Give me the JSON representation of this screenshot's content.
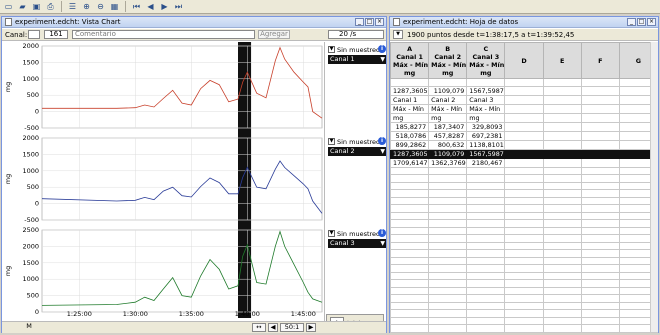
{
  "toolbar": {
    "icons": [
      "new-icon",
      "open-icon",
      "save-icon",
      "print-icon",
      "list-icon",
      "zoom-in-icon",
      "zoom-out-icon",
      "spreadsheet-icon",
      "first-icon",
      "prev-icon",
      "next-icon",
      "last-icon"
    ]
  },
  "chart_window": {
    "title": "experiment.edchtː Vista Chart",
    "canal_label": "Canal:",
    "canal_number": "161",
    "comment_placeholder": "Comentario",
    "add_button": "Agregar",
    "rate": "20 /s",
    "channels": [
      {
        "name": "Canal 1",
        "sampling": "Sin muestreo",
        "color": "#c8402b",
        "unit": "mg",
        "yticks": [
          "2000",
          "1500",
          "1000",
          "500",
          "0",
          "-500"
        ],
        "ylim": [
          -500,
          2000
        ]
      },
      {
        "name": "Canal 2",
        "sampling": "Sin muestreo",
        "color": "#2a3c98",
        "unit": "mg",
        "yticks": [
          "2000",
          "1500",
          "1000",
          "500",
          "0",
          "-500"
        ],
        "ylim": [
          -500,
          2000
        ]
      },
      {
        "name": "Canal 3",
        "sampling": "Sin muestreo",
        "color": "#1e7a2a",
        "unit": "mg",
        "yticks": [
          "2500",
          "2000",
          "1500",
          "1000",
          "500",
          "0"
        ],
        "ylim": [
          0,
          2500
        ]
      }
    ],
    "x_ticks": [
      "1:25:00",
      "1:30:00",
      "1:35:00",
      "1:40:00",
      "1:45:00"
    ],
    "zoom_label": "50:1",
    "play_button": "Iniciar",
    "scroll_marker": "M"
  },
  "sheet_window": {
    "title": "experiment.edchtː Hoja de datos",
    "range_text": "1900 puntos desde t=1:38:17,5 a t=1:39:52,45",
    "columns": [
      "A",
      "B",
      "C",
      "D",
      "E",
      "F",
      "G"
    ],
    "col_headers": [
      [
        "Canal 1",
        "Máx - Mín",
        "mg"
      ],
      [
        "Canal 2",
        "Máx - Mín",
        "mg"
      ],
      [
        "Canal 3",
        "Máx - Mín",
        "mg"
      ]
    ],
    "summary_row": [
      "1287,3605",
      "1109,079",
      "1567,5987"
    ],
    "block_headers": [
      [
        "Canal 1",
        "Canal 2",
        "Canal 3"
      ],
      [
        "Máx - Mín",
        "Máx - Mín",
        "Máx - Mín"
      ],
      [
        "mg",
        "mg",
        "mg"
      ]
    ],
    "rows": [
      [
        "185,8277",
        "187,3407",
        "329,8093"
      ],
      [
        "518,0786",
        "457,8287",
        "697,2381"
      ],
      [
        "899,2862",
        "800,632",
        "1138,8101"
      ],
      [
        "1287,3605",
        "1109,079",
        "1567,5987"
      ],
      [
        "1709,6147",
        "1362,3769",
        "2180,467"
      ]
    ],
    "selected_row_index": 3
  },
  "chart_data": [
    {
      "type": "line",
      "title": "",
      "series": [
        {
          "name": "Canal 1",
          "x": [
            0,
            8,
            10,
            11,
            12,
            13,
            14,
            15,
            16,
            17,
            18,
            19,
            20,
            21,
            21.5,
            22,
            23,
            24,
            25,
            25.5,
            26,
            27,
            28,
            28.5,
            29,
            30
          ],
          "y": [
            100,
            100,
            120,
            200,
            140,
            400,
            650,
            260,
            200,
            700,
            950,
            820,
            300,
            380,
            900,
            1200,
            560,
            420,
            1550,
            1950,
            1600,
            1200,
            900,
            750,
            0,
            -200
          ]
        }
      ],
      "ylabel": "mg",
      "ylim": [
        -500,
        2000
      ]
    },
    {
      "type": "line",
      "title": "",
      "series": [
        {
          "name": "Canal 2",
          "x": [
            0,
            8,
            10,
            11,
            12,
            13,
            14,
            15,
            16,
            17,
            18,
            19,
            20,
            21,
            21.5,
            22,
            23,
            24,
            25,
            25.5,
            26,
            27,
            28,
            28.5,
            29,
            30
          ],
          "y": [
            150,
            80,
            100,
            190,
            120,
            380,
            500,
            240,
            200,
            520,
            780,
            640,
            300,
            300,
            800,
            1100,
            500,
            450,
            1050,
            1300,
            1100,
            850,
            600,
            450,
            80,
            -300
          ]
        }
      ],
      "ylabel": "mg",
      "ylim": [
        -500,
        2000
      ]
    },
    {
      "type": "line",
      "title": "",
      "series": [
        {
          "name": "Canal 3",
          "x": [
            0,
            8,
            10,
            11,
            12,
            13,
            14,
            15,
            16,
            17,
            18,
            19,
            20,
            21,
            21.5,
            22,
            23,
            24,
            25,
            25.5,
            26,
            27,
            28,
            28.5,
            29,
            30
          ],
          "y": [
            200,
            230,
            300,
            450,
            350,
            700,
            1050,
            500,
            450,
            1100,
            1600,
            1300,
            700,
            800,
            1700,
            2050,
            900,
            850,
            2000,
            2450,
            2000,
            1450,
            900,
            600,
            400,
            300
          ]
        }
      ],
      "ylabel": "mg",
      "ylim": [
        0,
        2500
      ]
    }
  ]
}
